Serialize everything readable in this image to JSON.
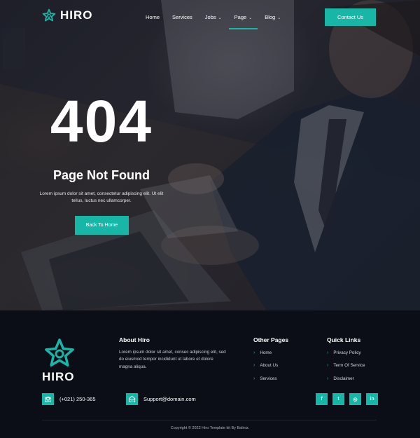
{
  "brand": {
    "name": "HIRO",
    "accent": "#17b6a7",
    "logo_icon": "star-icon"
  },
  "nav": {
    "items": [
      {
        "label": "Home",
        "dropdown": false
      },
      {
        "label": "Services",
        "dropdown": false
      },
      {
        "label": "Jobs",
        "dropdown": true
      },
      {
        "label": "Page",
        "dropdown": true,
        "active": true
      },
      {
        "label": "Blog",
        "dropdown": true
      }
    ],
    "cta_label": "Contact Us"
  },
  "hero": {
    "code": "404",
    "title": "Page Not Found",
    "description": "Lorem ipsum dolor sit amet, consectetur adipiscing elit. Ut elit tellus, luctus nec ullamcorper.",
    "button_label": "Back To Home"
  },
  "footer": {
    "about": {
      "title": "About Hiro",
      "text": "Lorem ipsum dolor sit amet, consec adipiscing elit, sed do eiusmod tempor incididunt ut labore et dolore magna aliqua."
    },
    "other_pages": {
      "title": "Other Pages",
      "links": [
        "Home",
        "About Us",
        "Services"
      ]
    },
    "quick_links": {
      "title": "Quick Links",
      "links": [
        "Privacy Policy",
        "Term Of Service",
        "Disclaimer"
      ]
    },
    "phone": "(+021) 250-365",
    "email": "Support@domain.com",
    "social": [
      {
        "icon": "facebook-icon",
        "glyph": "f"
      },
      {
        "icon": "twitter-icon",
        "glyph": "t"
      },
      {
        "icon": "instagram-icon",
        "glyph": "◎"
      },
      {
        "icon": "linkedin-icon",
        "glyph": "in"
      }
    ],
    "copyright": "Copyright © 2022 Hiro Template kit By Baliniz."
  }
}
